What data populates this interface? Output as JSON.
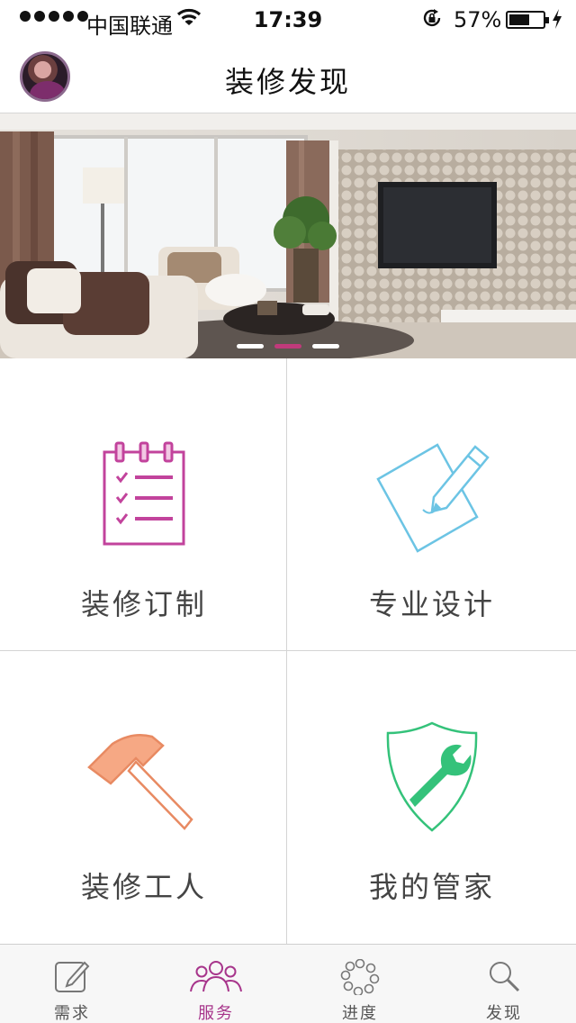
{
  "status_bar": {
    "carrier": "中国联通",
    "time": "17:39",
    "battery_percent": "57%",
    "battery_level": 0.57
  },
  "nav": {
    "title": "装修发现"
  },
  "banner": {
    "page_count": 3,
    "active_page": 1
  },
  "services": [
    {
      "label": "装修订制",
      "icon": "checklist-icon",
      "color": "#c2439c"
    },
    {
      "label": "专业设计",
      "icon": "pencil-paper-icon",
      "color": "#6cc4e4"
    },
    {
      "label": "装修工人",
      "icon": "hammer-icon",
      "color": "#f09a6a"
    },
    {
      "label": "我的管家",
      "icon": "shield-wrench-icon",
      "color": "#34c27a"
    }
  ],
  "tab_bar": {
    "tabs": [
      {
        "label": "需求",
        "icon": "compose-icon",
        "active": false
      },
      {
        "label": "服务",
        "icon": "people-icon",
        "active": true
      },
      {
        "label": "进度",
        "icon": "progress-ring-icon",
        "active": false
      },
      {
        "label": "发现",
        "icon": "search-icon",
        "active": false
      }
    ]
  },
  "colors": {
    "accent": "#a7358b",
    "active_dot": "#c03a7b"
  }
}
